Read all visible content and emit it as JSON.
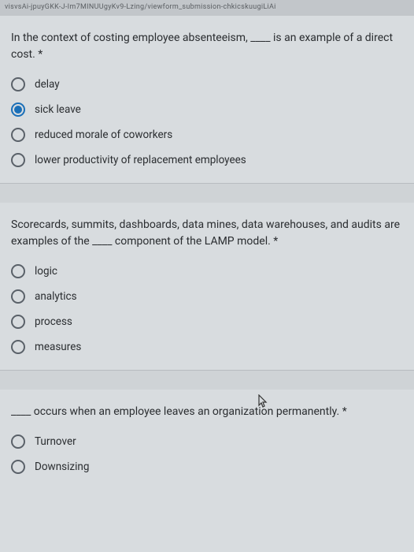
{
  "url_fragment": "visvsAi-jpuyGKK-J-Im7MINUUgyKv9-Lzing/viewform_submission-chkicskuugiLiAi",
  "questions": [
    {
      "text": "In the context of costing employee absenteeism, ____ is an example of a direct cost. *",
      "options": [
        {
          "label": "delay",
          "selected": false
        },
        {
          "label": "sick leave",
          "selected": true
        },
        {
          "label": "reduced morale of coworkers",
          "selected": false
        },
        {
          "label": "lower productivity of replacement employees",
          "selected": false
        }
      ]
    },
    {
      "text": "Scorecards, summits, dashboards, data mines, data warehouses, and audits are examples of the ____ component of the LAMP model. *",
      "options": [
        {
          "label": "logic",
          "selected": false
        },
        {
          "label": "analytics",
          "selected": false
        },
        {
          "label": "process",
          "selected": false
        },
        {
          "label": "measures",
          "selected": false
        }
      ]
    },
    {
      "text": "____ occurs when an employee leaves an organization permanently. *",
      "options": [
        {
          "label": "Turnover",
          "selected": false
        },
        {
          "label": "Downsizing",
          "selected": false
        }
      ]
    }
  ]
}
